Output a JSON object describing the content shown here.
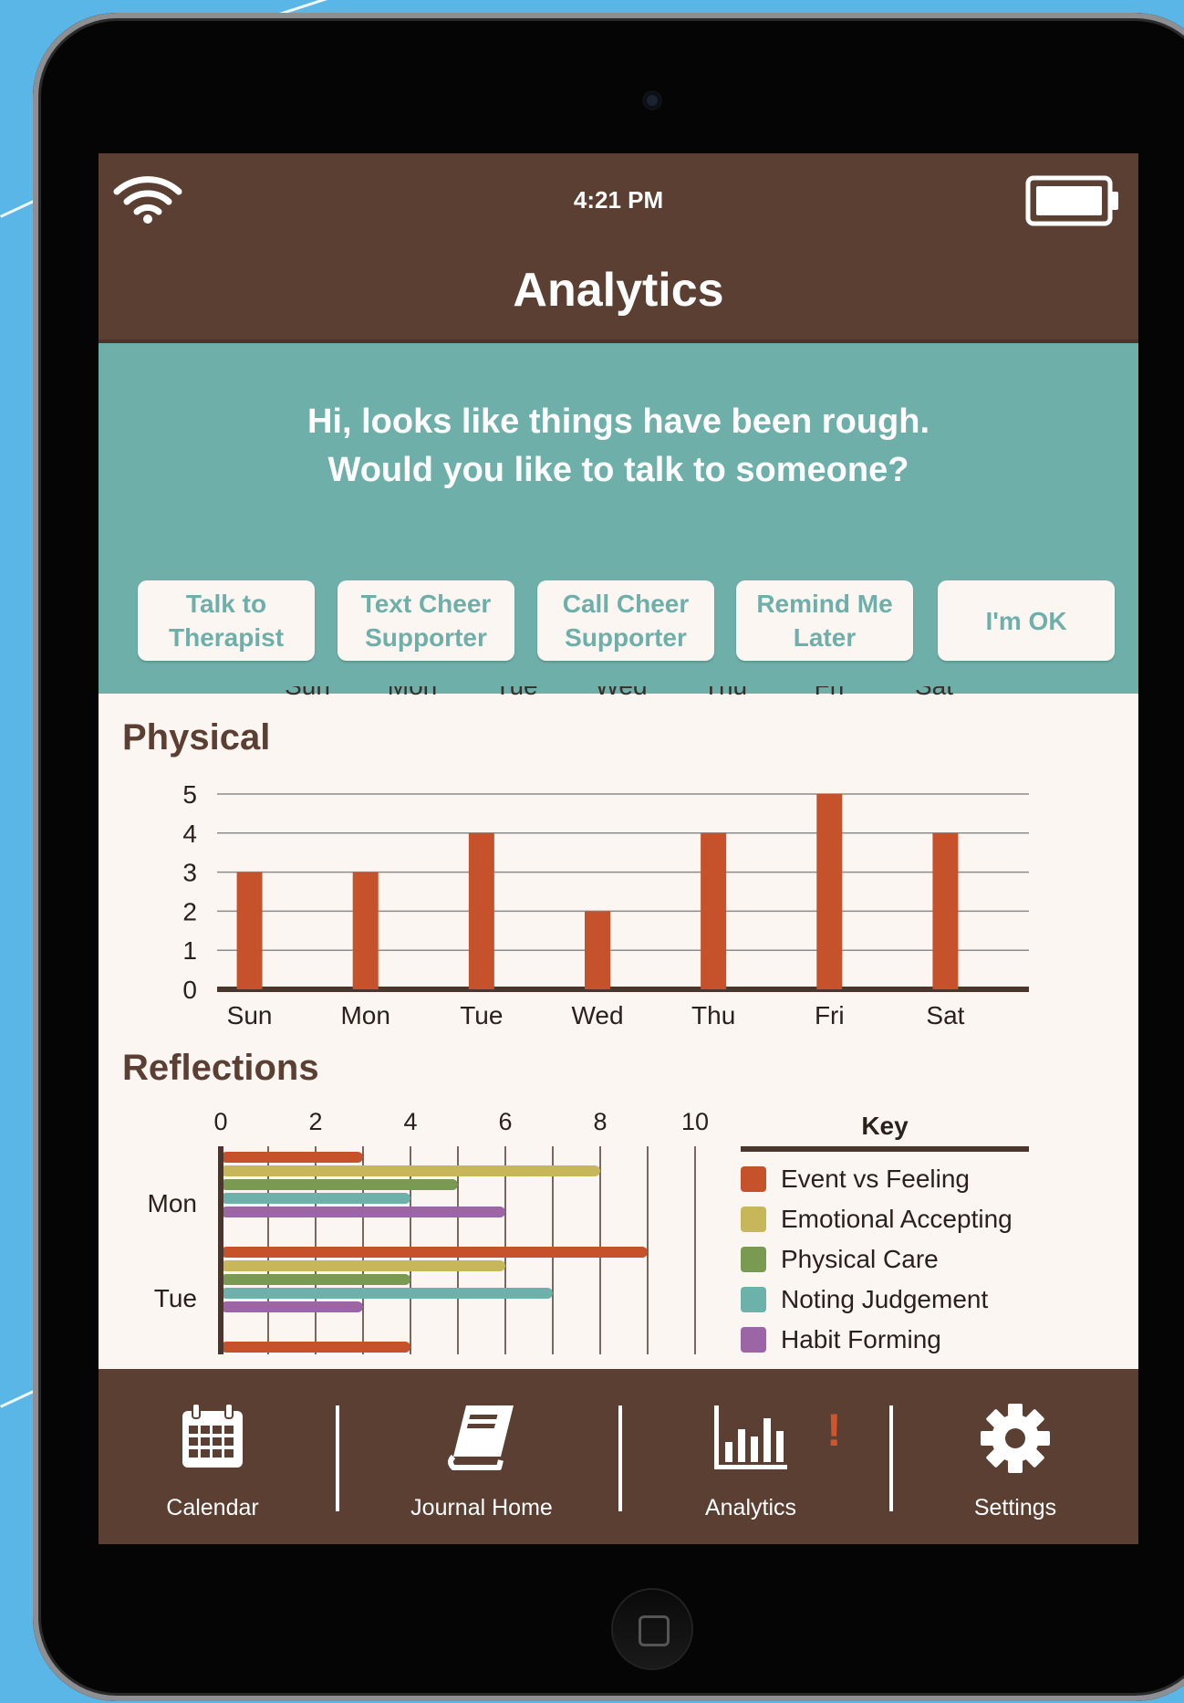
{
  "status_bar": {
    "time": "4:21 PM"
  },
  "header": {
    "title": "Analytics"
  },
  "banner": {
    "message_line1": "Hi, looks like things have been rough.",
    "message_line2": "Would you like to talk to someone?",
    "buttons": [
      {
        "label": "Talk to\nTherapist"
      },
      {
        "label": "Text Cheer\nSupporter"
      },
      {
        "label": "Call Cheer\nSupporter"
      },
      {
        "label": "Remind Me\nLater"
      },
      {
        "label": "I'm OK"
      }
    ]
  },
  "physical": {
    "title": "Physical"
  },
  "reflections": {
    "title": "Reflections"
  },
  "colors": {
    "brown": "#5b3f32",
    "teal": "#6fafa9",
    "event_vs_feeling": "#c6522b",
    "emotional_accepting": "#c7b65a",
    "physical_care": "#789a51",
    "noting_judgement": "#6db1ab",
    "habit_forming": "#9b65a6"
  },
  "chart_data": [
    {
      "type": "bar",
      "title": "Physical",
      "categories": [
        "Sun",
        "Mon",
        "Tue",
        "Wed",
        "Thu",
        "Fri",
        "Sat"
      ],
      "values": [
        3,
        3,
        4,
        2,
        4,
        5,
        4
      ],
      "ylim": [
        0,
        5
      ],
      "yticks": [
        "0",
        "1",
        "2",
        "3",
        "4",
        "5"
      ],
      "grid": true
    },
    {
      "type": "bar",
      "orientation": "horizontal",
      "title": "Reflections",
      "categories": [
        "Mon",
        "Tue"
      ],
      "xticks": [
        "0",
        "2",
        "4",
        "6",
        "8",
        "10"
      ],
      "xlim": [
        0,
        10
      ],
      "legend_title": "Key",
      "legend_position": "right",
      "series": [
        {
          "name": "Event vs Feeling",
          "values": [
            3,
            9
          ]
        },
        {
          "name": "Emotional Accepting",
          "values": [
            8,
            6
          ]
        },
        {
          "name": "Physical Care",
          "values": [
            5,
            4
          ]
        },
        {
          "name": "Noting Judgement",
          "values": [
            4,
            7
          ]
        },
        {
          "name": "Habit Forming",
          "values": [
            6,
            3
          ]
        }
      ],
      "partial_third_row_value": 4
    }
  ],
  "clipped_days": [
    "Sun",
    "Mon",
    "Tue",
    "Wed",
    "Thu",
    "Fri",
    "Sat"
  ],
  "tabs": [
    {
      "label": "Calendar",
      "icon": "calendar-icon"
    },
    {
      "label": "Journal Home",
      "icon": "book-icon"
    },
    {
      "label": "Analytics",
      "icon": "bar-chart-icon",
      "alert": "!"
    },
    {
      "label": "Settings",
      "icon": "gear-icon"
    }
  ]
}
